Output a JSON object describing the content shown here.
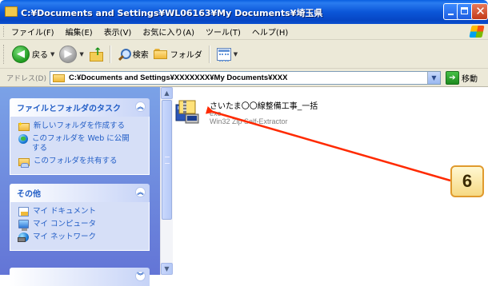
{
  "window": {
    "title": "C:¥Documents and Settings¥WL06163¥My Documents¥埼玉県"
  },
  "menu": {
    "items": [
      {
        "label": "ファイル(F)"
      },
      {
        "label": "編集(E)"
      },
      {
        "label": "表示(V)"
      },
      {
        "label": "お気に入り(A)"
      },
      {
        "label": "ツール(T)"
      },
      {
        "label": "ヘルプ(H)"
      }
    ]
  },
  "toolbar": {
    "back_label": "戻る",
    "search_label": "検索",
    "folders_label": "フォルダ"
  },
  "address": {
    "label": "アドレス(D)",
    "path": "C:¥Documents and Settings¥XXXXXXX¥My Documents¥XXX",
    "go_label": "移動"
  },
  "taskpane": {
    "file_tasks": {
      "header": "ファイルとフォルダのタスク",
      "items": [
        {
          "label": "新しいフォルダを作成する",
          "icon": "new-folder-icon"
        },
        {
          "label": "このフォルダを Web に公開\nする",
          "icon": "globe-icon"
        },
        {
          "label": "このフォルダを共有する",
          "icon": "share-folder-icon"
        }
      ]
    },
    "other_places": {
      "header": "その他",
      "items": [
        {
          "label": "マイ ドキュメント",
          "icon": "my-documents-icon"
        },
        {
          "label": "マイ コンピュータ",
          "icon": "my-computer-icon"
        },
        {
          "label": "マイ ネットワーク",
          "icon": "my-network-icon"
        }
      ]
    }
  },
  "file": {
    "name": "さいたま〇〇線整備工事_一括",
    "type": "exe",
    "description": "Win32 Zip Self-Extractor"
  },
  "callout": {
    "number": "6"
  },
  "colors": {
    "titlebar": "#0b56d8",
    "taskpane_link": "#215dc6",
    "callout_border": "#e09a2d",
    "arrow": "#ff2a00"
  }
}
